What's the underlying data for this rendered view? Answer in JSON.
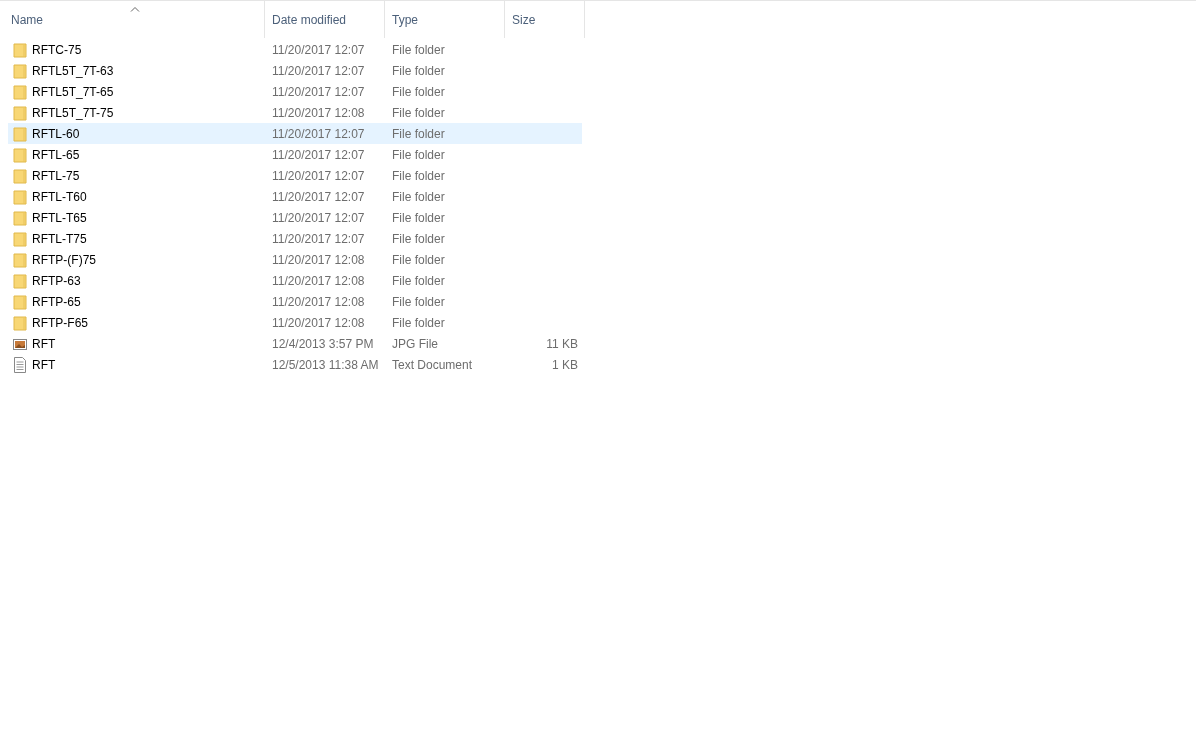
{
  "columns": [
    "Name",
    "Date modified",
    "Type",
    "Size"
  ],
  "rows": [
    {
      "name": "RFTC-75",
      "date": "11/20/2017 12:07",
      "type": "File folder",
      "size": "",
      "kind": "folder",
      "selected": false
    },
    {
      "name": "RFTL5T_7T-63",
      "date": "11/20/2017 12:07",
      "type": "File folder",
      "size": "",
      "kind": "folder",
      "selected": false
    },
    {
      "name": "RFTL5T_7T-65",
      "date": "11/20/2017 12:07",
      "type": "File folder",
      "size": "",
      "kind": "folder",
      "selected": false
    },
    {
      "name": "RFTL5T_7T-75",
      "date": "11/20/2017 12:08",
      "type": "File folder",
      "size": "",
      "kind": "folder",
      "selected": false
    },
    {
      "name": "RFTL-60",
      "date": "11/20/2017 12:07",
      "type": "File folder",
      "size": "",
      "kind": "folder",
      "selected": true
    },
    {
      "name": "RFTL-65",
      "date": "11/20/2017 12:07",
      "type": "File folder",
      "size": "",
      "kind": "folder",
      "selected": false
    },
    {
      "name": "RFTL-75",
      "date": "11/20/2017 12:07",
      "type": "File folder",
      "size": "",
      "kind": "folder",
      "selected": false
    },
    {
      "name": "RFTL-T60",
      "date": "11/20/2017 12:07",
      "type": "File folder",
      "size": "",
      "kind": "folder",
      "selected": false
    },
    {
      "name": "RFTL-T65",
      "date": "11/20/2017 12:07",
      "type": "File folder",
      "size": "",
      "kind": "folder",
      "selected": false
    },
    {
      "name": "RFTL-T75",
      "date": "11/20/2017 12:07",
      "type": "File folder",
      "size": "",
      "kind": "folder",
      "selected": false
    },
    {
      "name": "RFTP-(F)75",
      "date": "11/20/2017 12:08",
      "type": "File folder",
      "size": "",
      "kind": "folder",
      "selected": false
    },
    {
      "name": "RFTP-63",
      "date": "11/20/2017 12:08",
      "type": "File folder",
      "size": "",
      "kind": "folder",
      "selected": false
    },
    {
      "name": "RFTP-65",
      "date": "11/20/2017 12:08",
      "type": "File folder",
      "size": "",
      "kind": "folder",
      "selected": false
    },
    {
      "name": "RFTP-F65",
      "date": "11/20/2017 12:08",
      "type": "File folder",
      "size": "",
      "kind": "folder",
      "selected": false
    },
    {
      "name": "RFT",
      "date": "12/4/2013 3:57 PM",
      "type": "JPG File",
      "size": "11 KB",
      "kind": "image",
      "selected": false
    },
    {
      "name": "RFT",
      "date": "12/5/2013 11:38 AM",
      "type": "Text Document",
      "size": "1 KB",
      "kind": "text",
      "selected": false
    }
  ]
}
